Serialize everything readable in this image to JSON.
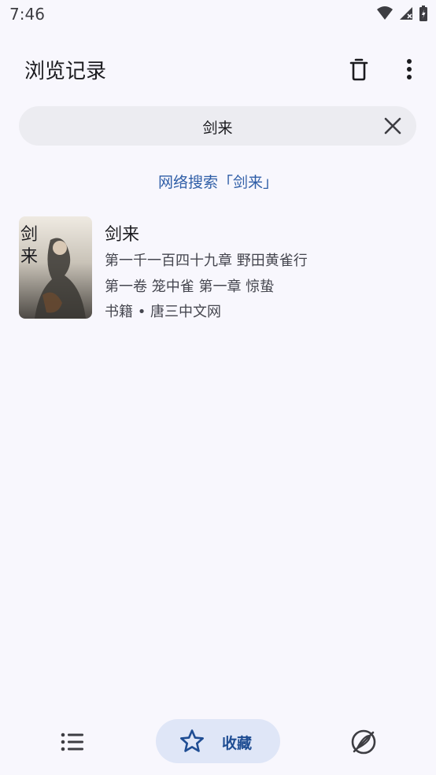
{
  "status_bar": {
    "time": "7:46"
  },
  "app_bar": {
    "title": "浏览记录",
    "trash_icon": "trash-icon",
    "more_icon": "more-vert-icon"
  },
  "search": {
    "query": "剑来",
    "clear_icon": "close-icon"
  },
  "web_search_link": "网络搜索「剑来」",
  "result": {
    "title": "剑来",
    "line1": "第一千一百四十九章 野田黄雀行",
    "line2": "第一卷 笼中雀 第一章 惊蛰",
    "line3": "书籍 • 唐三中文网",
    "cover_title": "剑来"
  },
  "bottom_nav": {
    "list_icon": "list-icon",
    "favorites_label": "收藏",
    "favorites_icon": "star-icon",
    "explore_icon": "explore-icon"
  },
  "colors": {
    "accent": "#1f4d93",
    "link": "#2f5ea7",
    "background": "#f8f7fd"
  }
}
